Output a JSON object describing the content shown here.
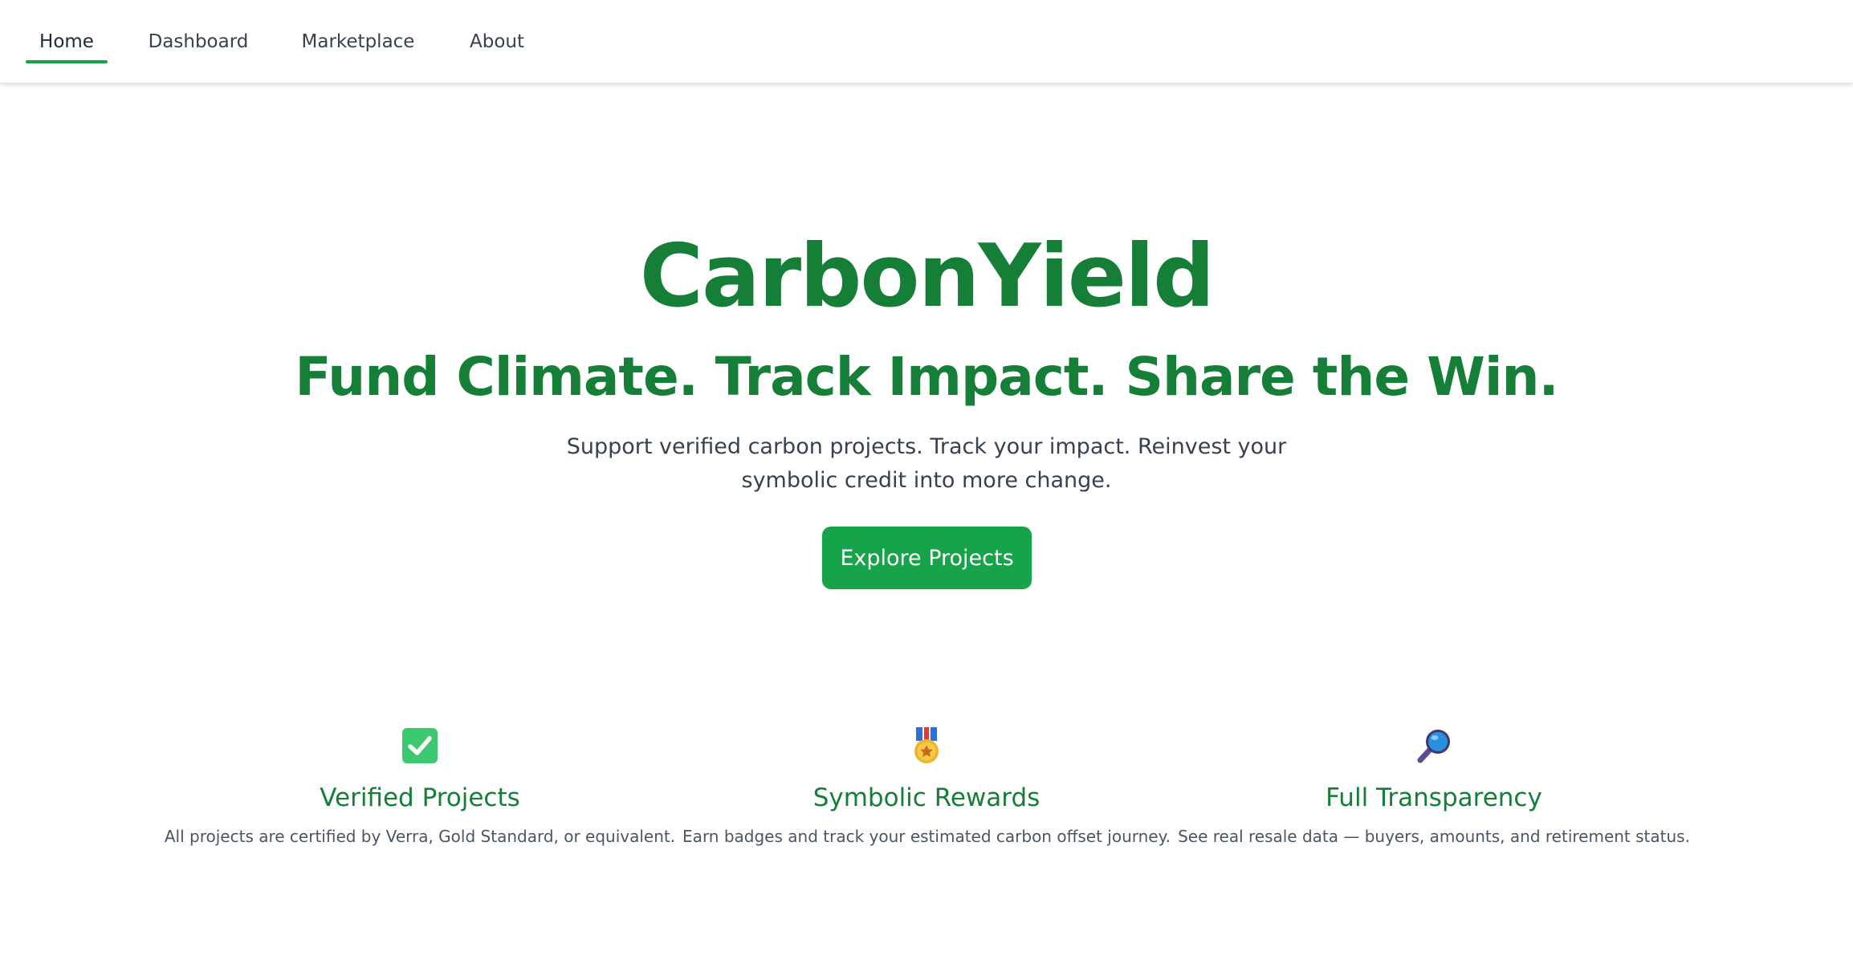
{
  "nav": {
    "items": [
      {
        "label": "Home",
        "active": true
      },
      {
        "label": "Dashboard",
        "active": false
      },
      {
        "label": "Marketplace",
        "active": false
      },
      {
        "label": "About",
        "active": false
      }
    ]
  },
  "hero": {
    "title": "CarbonYield",
    "subtitle": "Fund Climate. Track Impact. Share the Win.",
    "description": "Support verified carbon projects. Track your impact. Reinvest your symbolic credit into more change.",
    "cta_label": "Explore Projects"
  },
  "features": [
    {
      "icon": "checkbox-icon",
      "title": "Verified Projects",
      "description": "All projects are certified by Verra, Gold Standard, or equivalent."
    },
    {
      "icon": "medal-icon",
      "title": "Symbolic Rewards",
      "description": "Earn badges and track your estimated carbon offset journey."
    },
    {
      "icon": "magnifying-glass-icon",
      "title": "Full Transparency",
      "description": "See real resale data — buyers, amounts, and retirement status."
    }
  ],
  "colors": {
    "brand_green": "#157f37",
    "accent_green": "#16a34a",
    "text_primary": "#374151",
    "text_secondary": "#4b5563"
  }
}
